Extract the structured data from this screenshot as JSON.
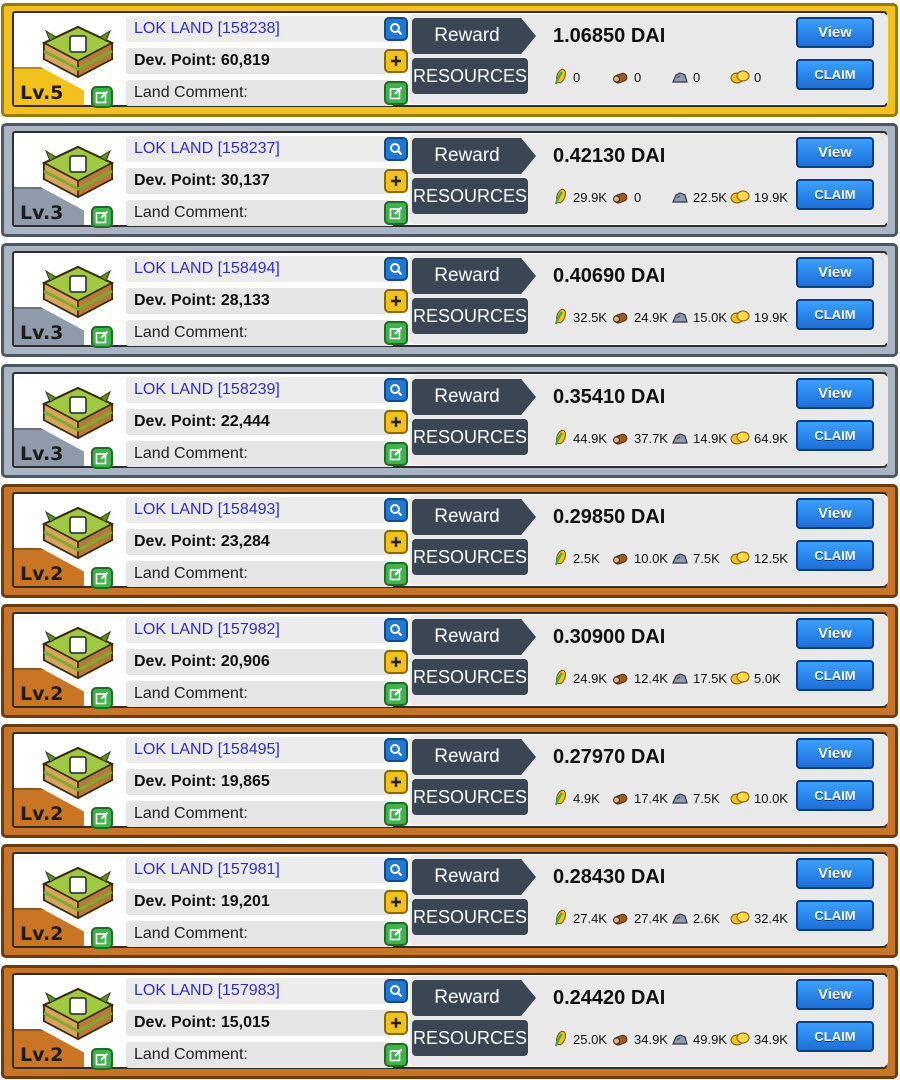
{
  "labels": {
    "reward": "Reward",
    "resources": "RESOURCES",
    "view": "View",
    "claim": "CLAIM",
    "comment": "Land Comment:"
  },
  "colors": {
    "gold": "#f2c21a",
    "silver": "#aab5c3",
    "bronze": "#c97524",
    "land_name": "#2d2dd1",
    "button_blue": "#1d6fd9",
    "label_dark": "#3b4655"
  },
  "icons": {
    "search": "magnifier-icon",
    "add": "plus-icon",
    "edit": "edit-icon",
    "land": "land-tile-icon",
    "resources": [
      "corn-icon",
      "wood-log-icon",
      "stone-icon",
      "gold-coin-icon"
    ]
  },
  "cards": [
    {
      "tier": "gold",
      "level": "Lv.5",
      "land": "LOK LAND [158238]",
      "dev": "Dev. Point: 60,819",
      "reward": "1.06850 DAI",
      "res": [
        "0",
        "0",
        "0",
        "0"
      ]
    },
    {
      "tier": "silver",
      "level": "Lv.3",
      "land": "LOK LAND [158237]",
      "dev": "Dev. Point: 30,137",
      "reward": "0.42130 DAI",
      "res": [
        "29.9K",
        "0",
        "22.5K",
        "19.9K"
      ]
    },
    {
      "tier": "silver",
      "level": "Lv.3",
      "land": "LOK LAND [158494]",
      "dev": "Dev. Point: 28,133",
      "reward": "0.40690 DAI",
      "res": [
        "32.5K",
        "24.9K",
        "15.0K",
        "19.9K"
      ]
    },
    {
      "tier": "silver",
      "level": "Lv.3",
      "land": "LOK LAND [158239]",
      "dev": "Dev. Point: 22,444",
      "reward": "0.35410 DAI",
      "res": [
        "44.9K",
        "37.7K",
        "14.9K",
        "64.9K"
      ]
    },
    {
      "tier": "bronze",
      "level": "Lv.2",
      "land": "LOK LAND [158493]",
      "dev": "Dev. Point: 23,284",
      "reward": "0.29850 DAI",
      "res": [
        "2.5K",
        "10.0K",
        "7.5K",
        "12.5K"
      ]
    },
    {
      "tier": "bronze",
      "level": "Lv.2",
      "land": "LOK LAND [157982]",
      "dev": "Dev. Point: 20,906",
      "reward": "0.30900 DAI",
      "res": [
        "24.9K",
        "12.4K",
        "17.5K",
        "5.0K"
      ]
    },
    {
      "tier": "bronze",
      "level": "Lv.2",
      "land": "LOK LAND [158495]",
      "dev": "Dev. Point: 19,865",
      "reward": "0.27970 DAI",
      "res": [
        "4.9K",
        "17.4K",
        "7.5K",
        "10.0K"
      ]
    },
    {
      "tier": "bronze",
      "level": "Lv.2",
      "land": "LOK LAND [157981]",
      "dev": "Dev. Point: 19,201",
      "reward": "0.28430 DAI",
      "res": [
        "27.4K",
        "27.4K",
        "2.6K",
        "32.4K"
      ]
    },
    {
      "tier": "bronze",
      "level": "Lv.2",
      "land": "LOK LAND [157983]",
      "dev": "Dev. Point: 15,015",
      "reward": "0.24420 DAI",
      "res": [
        "25.0K",
        "34.9K",
        "49.9K",
        "34.9K"
      ]
    }
  ]
}
